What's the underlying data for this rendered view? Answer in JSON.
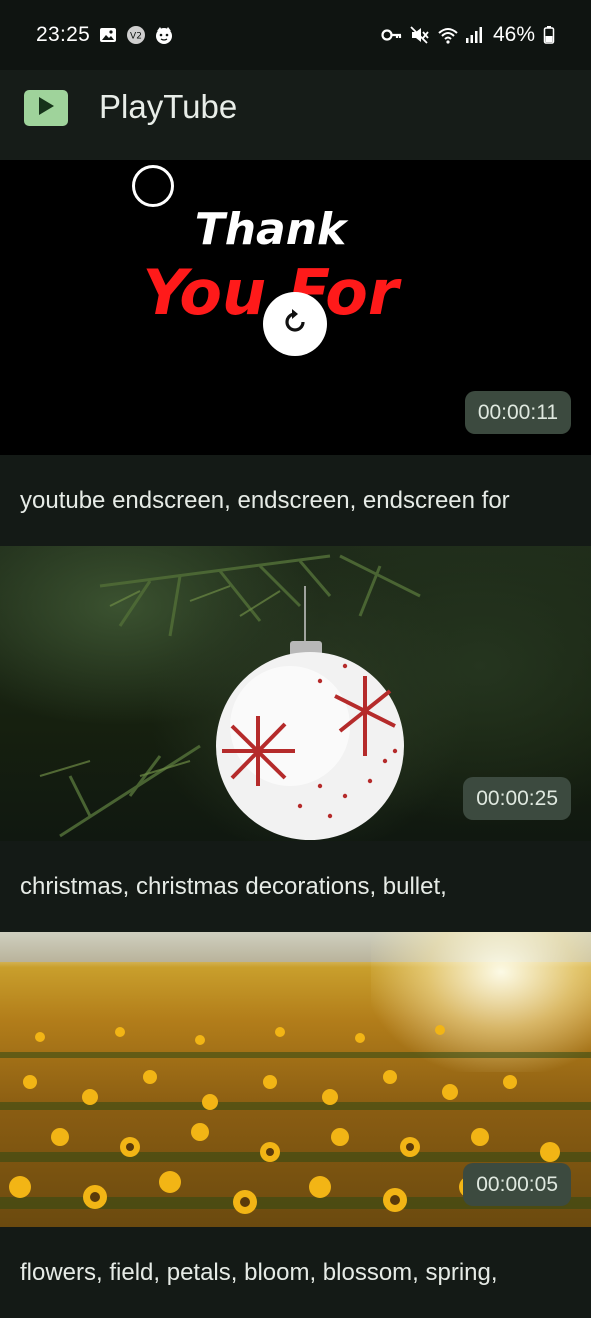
{
  "status_bar": {
    "time": "23:25",
    "battery": "46%",
    "left_icons": [
      "image-icon",
      "v2-icon",
      "cat-face-icon"
    ],
    "right_icons": [
      "key-icon",
      "mute-icon",
      "wifi-icon",
      "signal-icon",
      "battery-icon"
    ]
  },
  "app_bar": {
    "title": "PlayTube",
    "logo_icon": "play-icon",
    "accent": "#9fd39b"
  },
  "videos": [
    {
      "overlay_line1": "Thank",
      "overlay_line2": "You For",
      "duration": "00:00:11",
      "caption": "youtube endscreen, endscreen, endscreen for",
      "control_icon": "replay-icon"
    },
    {
      "duration": "00:00:25",
      "caption": "christmas, christmas decorations, bullet,"
    },
    {
      "duration": "00:00:05",
      "caption": "flowers, field, petals, bloom, blossom, spring,"
    }
  ],
  "colors": {
    "background": "#0f1411",
    "duration_badge": "#3c4a3f",
    "overlay_red": "#ff1a1a"
  }
}
